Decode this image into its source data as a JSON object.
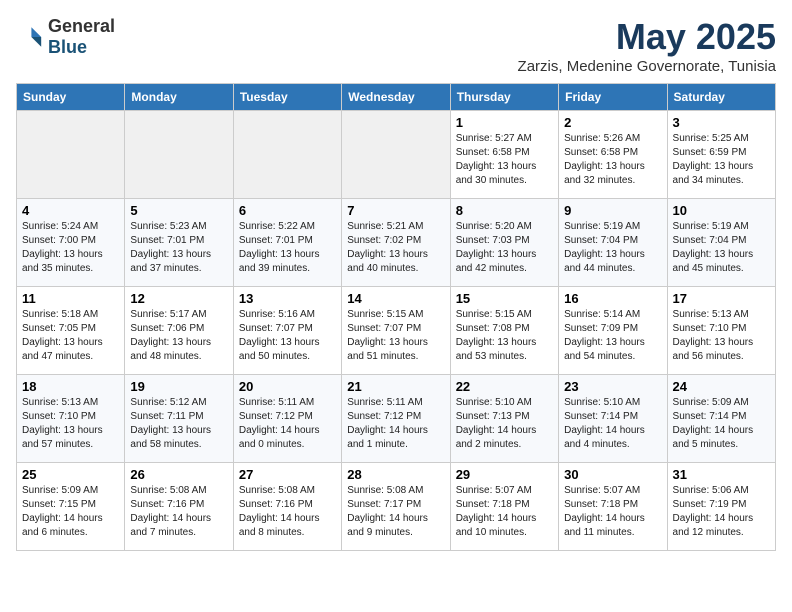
{
  "logo": {
    "general": "General",
    "blue": "Blue"
  },
  "title": "May 2025",
  "subtitle": "Zarzis, Medenine Governorate, Tunisia",
  "weekdays": [
    "Sunday",
    "Monday",
    "Tuesday",
    "Wednesday",
    "Thursday",
    "Friday",
    "Saturday"
  ],
  "weeks": [
    [
      {
        "day": "",
        "info": ""
      },
      {
        "day": "",
        "info": ""
      },
      {
        "day": "",
        "info": ""
      },
      {
        "day": "",
        "info": ""
      },
      {
        "day": "1",
        "info": "Sunrise: 5:27 AM\nSunset: 6:58 PM\nDaylight: 13 hours\nand 30 minutes."
      },
      {
        "day": "2",
        "info": "Sunrise: 5:26 AM\nSunset: 6:58 PM\nDaylight: 13 hours\nand 32 minutes."
      },
      {
        "day": "3",
        "info": "Sunrise: 5:25 AM\nSunset: 6:59 PM\nDaylight: 13 hours\nand 34 minutes."
      }
    ],
    [
      {
        "day": "4",
        "info": "Sunrise: 5:24 AM\nSunset: 7:00 PM\nDaylight: 13 hours\nand 35 minutes."
      },
      {
        "day": "5",
        "info": "Sunrise: 5:23 AM\nSunset: 7:01 PM\nDaylight: 13 hours\nand 37 minutes."
      },
      {
        "day": "6",
        "info": "Sunrise: 5:22 AM\nSunset: 7:01 PM\nDaylight: 13 hours\nand 39 minutes."
      },
      {
        "day": "7",
        "info": "Sunrise: 5:21 AM\nSunset: 7:02 PM\nDaylight: 13 hours\nand 40 minutes."
      },
      {
        "day": "8",
        "info": "Sunrise: 5:20 AM\nSunset: 7:03 PM\nDaylight: 13 hours\nand 42 minutes."
      },
      {
        "day": "9",
        "info": "Sunrise: 5:19 AM\nSunset: 7:04 PM\nDaylight: 13 hours\nand 44 minutes."
      },
      {
        "day": "10",
        "info": "Sunrise: 5:19 AM\nSunset: 7:04 PM\nDaylight: 13 hours\nand 45 minutes."
      }
    ],
    [
      {
        "day": "11",
        "info": "Sunrise: 5:18 AM\nSunset: 7:05 PM\nDaylight: 13 hours\nand 47 minutes."
      },
      {
        "day": "12",
        "info": "Sunrise: 5:17 AM\nSunset: 7:06 PM\nDaylight: 13 hours\nand 48 minutes."
      },
      {
        "day": "13",
        "info": "Sunrise: 5:16 AM\nSunset: 7:07 PM\nDaylight: 13 hours\nand 50 minutes."
      },
      {
        "day": "14",
        "info": "Sunrise: 5:15 AM\nSunset: 7:07 PM\nDaylight: 13 hours\nand 51 minutes."
      },
      {
        "day": "15",
        "info": "Sunrise: 5:15 AM\nSunset: 7:08 PM\nDaylight: 13 hours\nand 53 minutes."
      },
      {
        "day": "16",
        "info": "Sunrise: 5:14 AM\nSunset: 7:09 PM\nDaylight: 13 hours\nand 54 minutes."
      },
      {
        "day": "17",
        "info": "Sunrise: 5:13 AM\nSunset: 7:10 PM\nDaylight: 13 hours\nand 56 minutes."
      }
    ],
    [
      {
        "day": "18",
        "info": "Sunrise: 5:13 AM\nSunset: 7:10 PM\nDaylight: 13 hours\nand 57 minutes."
      },
      {
        "day": "19",
        "info": "Sunrise: 5:12 AM\nSunset: 7:11 PM\nDaylight: 13 hours\nand 58 minutes."
      },
      {
        "day": "20",
        "info": "Sunrise: 5:11 AM\nSunset: 7:12 PM\nDaylight: 14 hours\nand 0 minutes."
      },
      {
        "day": "21",
        "info": "Sunrise: 5:11 AM\nSunset: 7:12 PM\nDaylight: 14 hours\nand 1 minute."
      },
      {
        "day": "22",
        "info": "Sunrise: 5:10 AM\nSunset: 7:13 PM\nDaylight: 14 hours\nand 2 minutes."
      },
      {
        "day": "23",
        "info": "Sunrise: 5:10 AM\nSunset: 7:14 PM\nDaylight: 14 hours\nand 4 minutes."
      },
      {
        "day": "24",
        "info": "Sunrise: 5:09 AM\nSunset: 7:14 PM\nDaylight: 14 hours\nand 5 minutes."
      }
    ],
    [
      {
        "day": "25",
        "info": "Sunrise: 5:09 AM\nSunset: 7:15 PM\nDaylight: 14 hours\nand 6 minutes."
      },
      {
        "day": "26",
        "info": "Sunrise: 5:08 AM\nSunset: 7:16 PM\nDaylight: 14 hours\nand 7 minutes."
      },
      {
        "day": "27",
        "info": "Sunrise: 5:08 AM\nSunset: 7:16 PM\nDaylight: 14 hours\nand 8 minutes."
      },
      {
        "day": "28",
        "info": "Sunrise: 5:08 AM\nSunset: 7:17 PM\nDaylight: 14 hours\nand 9 minutes."
      },
      {
        "day": "29",
        "info": "Sunrise: 5:07 AM\nSunset: 7:18 PM\nDaylight: 14 hours\nand 10 minutes."
      },
      {
        "day": "30",
        "info": "Sunrise: 5:07 AM\nSunset: 7:18 PM\nDaylight: 14 hours\nand 11 minutes."
      },
      {
        "day": "31",
        "info": "Sunrise: 5:06 AM\nSunset: 7:19 PM\nDaylight: 14 hours\nand 12 minutes."
      }
    ]
  ]
}
